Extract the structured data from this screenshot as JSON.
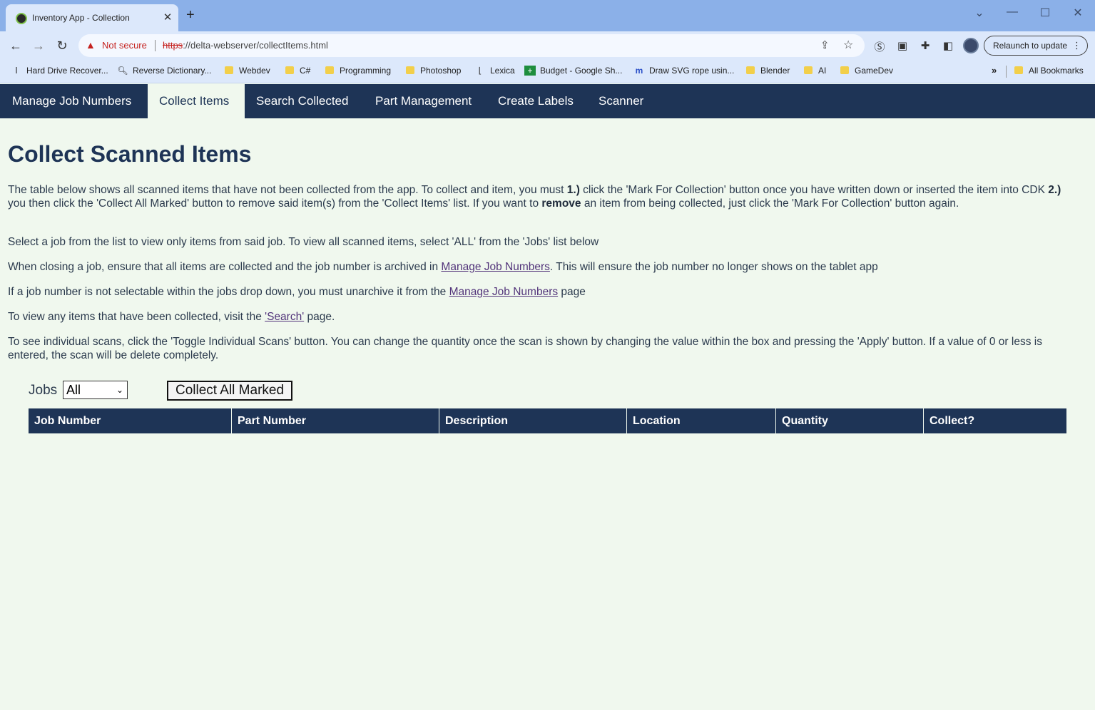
{
  "browser": {
    "tab_title": "Inventory App - Collection",
    "not_secure": "Not secure",
    "url_scheme": "https",
    "url_rest": "://delta-webserver/collectItems.html",
    "relaunch": "Relaunch to update",
    "bookmarks": [
      {
        "label": "Hard Drive Recover...",
        "icon": "one-icon"
      },
      {
        "label": "Reverse Dictionary...",
        "icon": "magnifier-icon"
      },
      {
        "label": "Webdev",
        "icon": "folder-icon"
      },
      {
        "label": "C#",
        "icon": "folder-icon"
      },
      {
        "label": "Programming",
        "icon": "folder-icon"
      },
      {
        "label": "Photoshop",
        "icon": "folder-icon"
      },
      {
        "label": "Lexica",
        "icon": "lexica-icon"
      },
      {
        "label": "Budget - Google Sh...",
        "icon": "sheets-icon"
      },
      {
        "label": "Draw SVG rope usin...",
        "icon": "mm-icon"
      },
      {
        "label": "Blender",
        "icon": "folder-icon"
      },
      {
        "label": "AI",
        "icon": "folder-icon"
      },
      {
        "label": "GameDev",
        "icon": "folder-icon"
      }
    ],
    "more_bookmarks": "»",
    "all_bookmarks": "All Bookmarks"
  },
  "nav": {
    "tabs": [
      "Manage Job Numbers",
      "Collect Items",
      "Search Collected",
      "Part Management",
      "Create Labels",
      "Scanner"
    ],
    "active": "Collect Items"
  },
  "page": {
    "title": "Collect Scanned Items",
    "p1": {
      "a": "The table below shows all scanned items that have not been collected from the app. To collect and item, you must ",
      "step1": "1.)",
      "b": " click the 'Mark For Collection' button once you have written down or inserted the item into CDK ",
      "step2": "2.)",
      "c": " you then click the 'Collect All Marked' button to remove said item(s) from the 'Collect Items' list. If you want to ",
      "remove": "remove",
      "d": " an item from being collected, just click the 'Mark For Collection' button again."
    },
    "p2": "Select a job from the list to view only items from said job. To view all scanned items, select 'ALL' from the 'Jobs' list below",
    "p3": {
      "a": "When closing a job, ensure that all items are collected and the job number is archived in ",
      "link": "Manage Job Numbers",
      "b": ". This will ensure the job number no longer shows on the tablet app"
    },
    "p4": {
      "a": "If a job number is not selectable within the jobs drop down, you must unarchive it from the ",
      "link": "Manage Job Numbers",
      "b": " page"
    },
    "p5": {
      "a": "To view any items that have been collected, visit the ",
      "link": "'Search'",
      "b": " page."
    },
    "p6": "To see individual scans, click the 'Toggle Individual Scans' button. You can change the quantity once the scan is shown by changing the value within the box and pressing the 'Apply' button. If a value of 0 or less is entered, the scan will be delete completely.",
    "jobs_label": "Jobs",
    "jobs_selected": "All",
    "collect_button": "Collect All Marked",
    "columns": [
      "Job Number",
      "Part Number",
      "Description",
      "Location",
      "Quantity",
      "Collect?"
    ]
  }
}
